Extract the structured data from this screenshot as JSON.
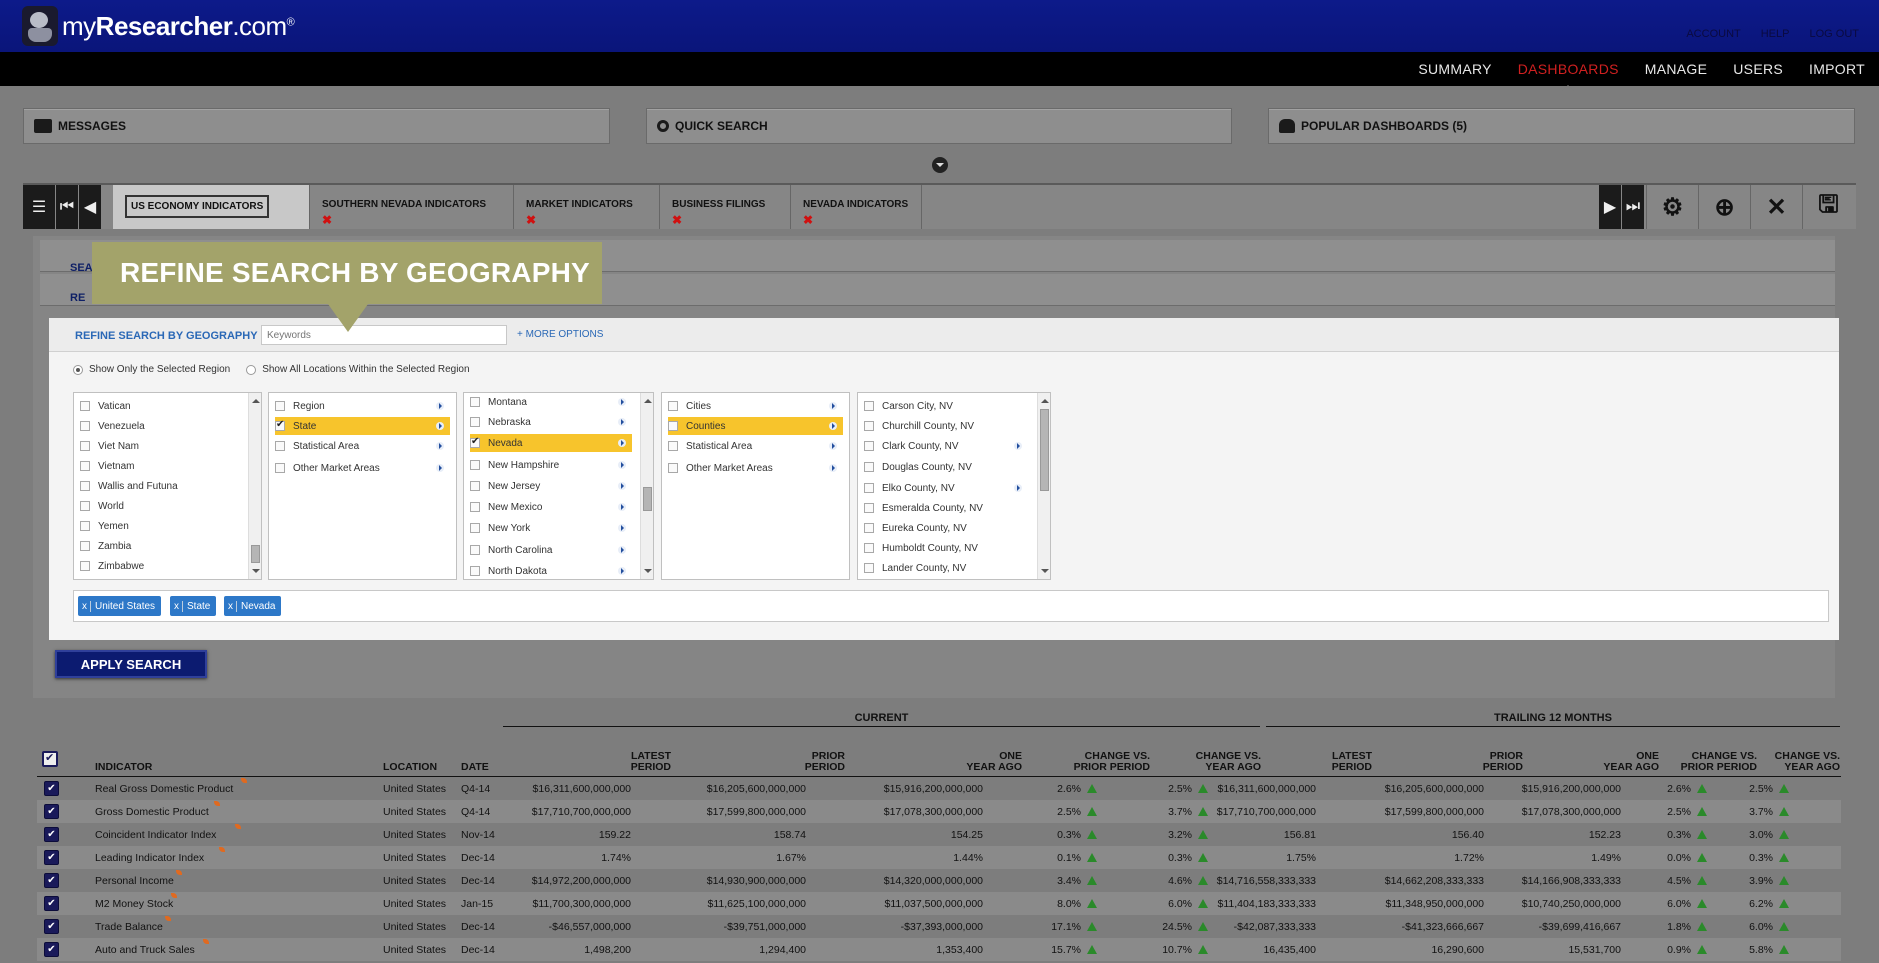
{
  "app": {
    "logo_prefix": "my",
    "logo_brand": "Researcher",
    "logo_suffix": ".com",
    "logo_reg": "®",
    "top_links": [
      "ACCOUNT",
      "HELP",
      "LOG OUT"
    ]
  },
  "nav": [
    "SUMMARY",
    "DASHBOARDS",
    "MANAGE",
    "USERS",
    "IMPORT"
  ],
  "nav_active": "DASHBOARDS",
  "panels": {
    "messages": "MESSAGES",
    "quick_search": "QUICK SEARCH",
    "popular": "POPULAR DASHBOARDS (5)"
  },
  "tabs": [
    {
      "label": "US ECONOMY INDICATORS"
    },
    {
      "label": "SOUTHERN NEVADA INDICATORS"
    },
    {
      "label": "MARKET INDICATORS"
    },
    {
      "label": "BUSINESS FILINGS"
    },
    {
      "label": "NEVADA INDICATORS"
    }
  ],
  "search": {
    "strip1": "SEAR",
    "strip2": "RE",
    "callout": "REFINE SEARCH BY GEOGRAPHY",
    "title": "REFINE SEARCH BY GEOGRAPHY",
    "keywords_placeholder": "Keywords",
    "more_options": "+ MORE OPTIONS",
    "radio_selected": "Show Only the Selected Region",
    "radio_all": "Show All Locations Within the Selected Region",
    "col1": [
      "Vatican",
      "Venezuela",
      "Viet Nam",
      "Vietnam",
      "Wallis and Futuna",
      "World",
      "Yemen",
      "Zambia",
      "Zimbabwe"
    ],
    "col2": [
      "Region",
      "State",
      "Statistical Area",
      "Other Market Areas"
    ],
    "col3": [
      "Montana",
      "Nebraska",
      "Nevada",
      "New Hampshire",
      "New Jersey",
      "New Mexico",
      "New York",
      "North Carolina",
      "North Dakota"
    ],
    "col4": [
      "Cities",
      "Counties",
      "Statistical Area",
      "Other Market Areas"
    ],
    "col5": [
      "Carson City, NV",
      "Churchill County, NV",
      "Clark County, NV",
      "Douglas County, NV",
      "Elko County, NV",
      "Esmeralda County, NV",
      "Eureka County, NV",
      "Humboldt County, NV",
      "Lander County, NV"
    ],
    "chips": [
      "United States",
      "State",
      "Nevada"
    ],
    "chip_x": "x",
    "apply": "APPLY SEARCH"
  },
  "table": {
    "group_current": "CURRENT",
    "group_trailing": "TRAILING 12 MONTHS",
    "headers": {
      "indicator": "INDICATOR",
      "location": "LOCATION",
      "date": "DATE",
      "latest_1": "LATEST",
      "latest_2": "PERIOD",
      "prior_1": "PRIOR",
      "prior_2": "PERIOD",
      "one_1": "ONE",
      "one_2": "YEAR AGO",
      "cvp_1": "CHANGE VS.",
      "cvp_2": "PRIOR PERIOD",
      "cvy_1": "CHANGE VS.",
      "cvy_2": "YEAR AGO"
    },
    "rows": [
      {
        "indicator": "Real Gross Domestic Product",
        "location": "United States",
        "date": "Q4-14",
        "latest": "$16,311,600,000,000",
        "prior": "$16,205,600,000,000",
        "one_year": "$15,916,200,000,000",
        "chg_prior": "2.6%",
        "chg_year": "2.5%",
        "t_latest": "$16,311,600,000,000",
        "t_prior": "$16,205,600,000,000",
        "t_one_year": "$15,916,200,000,000",
        "t_chg_prior": "2.6%",
        "t_chg_year": "2.5%"
      },
      {
        "indicator": "Gross Domestic Product",
        "location": "United States",
        "date": "Q4-14",
        "latest": "$17,710,700,000,000",
        "prior": "$17,599,800,000,000",
        "one_year": "$17,078,300,000,000",
        "chg_prior": "2.5%",
        "chg_year": "3.7%",
        "t_latest": "$17,710,700,000,000",
        "t_prior": "$17,599,800,000,000",
        "t_one_year": "$17,078,300,000,000",
        "t_chg_prior": "2.5%",
        "t_chg_year": "3.7%"
      },
      {
        "indicator": "Coincident Indicator Index",
        "location": "United States",
        "date": "Nov-14",
        "latest": "159.22",
        "prior": "158.74",
        "one_year": "154.25",
        "chg_prior": "0.3%",
        "chg_year": "3.2%",
        "t_latest": "156.81",
        "t_prior": "156.40",
        "t_one_year": "152.23",
        "t_chg_prior": "0.3%",
        "t_chg_year": "3.0%"
      },
      {
        "indicator": "Leading Indicator Index",
        "location": "United States",
        "date": "Dec-14",
        "latest": "1.74%",
        "prior": "1.67%",
        "one_year": "1.44%",
        "chg_prior": "0.1%",
        "chg_year": "0.3%",
        "t_latest": "1.75%",
        "t_prior": "1.72%",
        "t_one_year": "1.49%",
        "t_chg_prior": "0.0%",
        "t_chg_year": "0.3%"
      },
      {
        "indicator": "Personal Income",
        "location": "United States",
        "date": "Dec-14",
        "latest": "$14,972,200,000,000",
        "prior": "$14,930,900,000,000",
        "one_year": "$14,320,000,000,000",
        "chg_prior": "3.4%",
        "chg_year": "4.6%",
        "t_latest": "$14,716,558,333,333",
        "t_prior": "$14,662,208,333,333",
        "t_one_year": "$14,166,908,333,333",
        "t_chg_prior": "4.5%",
        "t_chg_year": "3.9%"
      },
      {
        "indicator": "M2 Money Stock",
        "location": "United States",
        "date": "Jan-15",
        "latest": "$11,700,300,000,000",
        "prior": "$11,625,100,000,000",
        "one_year": "$11,037,500,000,000",
        "chg_prior": "8.0%",
        "chg_year": "6.0%",
        "t_latest": "$11,404,183,333,333",
        "t_prior": "$11,348,950,000,000",
        "t_one_year": "$10,740,250,000,000",
        "t_chg_prior": "6.0%",
        "t_chg_year": "6.2%"
      },
      {
        "indicator": "Trade Balance",
        "location": "United States",
        "date": "Dec-14",
        "latest": "-$46,557,000,000",
        "prior": "-$39,751,000,000",
        "one_year": "-$37,393,000,000",
        "chg_prior": "17.1%",
        "chg_year": "24.5%",
        "t_latest": "-$42,087,333,333",
        "t_prior": "-$41,323,666,667",
        "t_one_year": "-$39,699,416,667",
        "t_chg_prior": "1.8%",
        "t_chg_year": "6.0%"
      },
      {
        "indicator": "Auto and Truck Sales",
        "location": "United States",
        "date": "Dec-14",
        "latest": "1,498,200",
        "prior": "1,294,400",
        "one_year": "1,353,400",
        "chg_prior": "15.7%",
        "chg_year": "10.7%",
        "t_latest": "16,435,400",
        "t_prior": "16,290,600",
        "t_one_year": "15,531,700",
        "t_chg_prior": "0.9%",
        "t_chg_year": "5.8%"
      }
    ]
  }
}
